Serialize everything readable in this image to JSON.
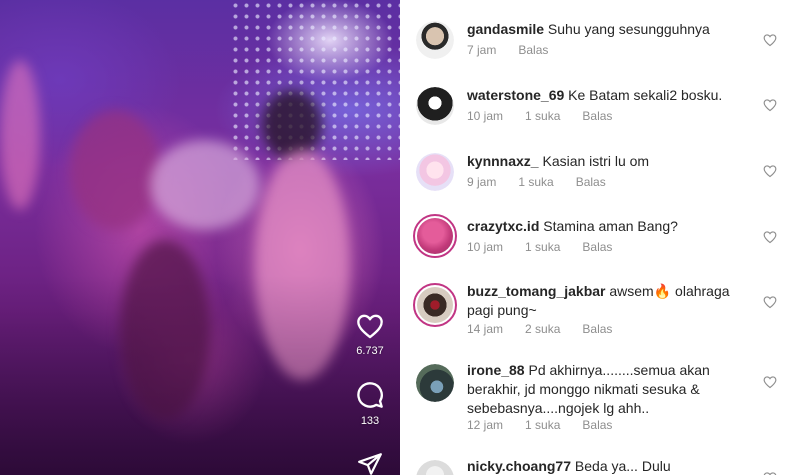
{
  "video": {
    "likes_count": "6.737",
    "comments_count": "133"
  },
  "comments": [
    {
      "username": "gandasmile",
      "text": "Suhu yang sesungguhnya",
      "time": "7 jam",
      "likes": "",
      "reply": "Balas"
    },
    {
      "username": "waterstone_69",
      "text": "Ke Batam sekali2 bosku.",
      "time": "10 jam",
      "likes": "1 suka",
      "reply": "Balas"
    },
    {
      "username": "kynnnaxz_",
      "text": "Kasian istri lu om",
      "time": "9 jam",
      "likes": "1 suka",
      "reply": "Balas"
    },
    {
      "username": "crazytxc.id",
      "text": "Stamina aman Bang?",
      "time": "10 jam",
      "likes": "1 suka",
      "reply": "Balas"
    },
    {
      "username": "buzz_tomang_jakbar",
      "text": "awsem🔥 olahraga pagi pung~",
      "time": "14 jam",
      "likes": "2 suka",
      "reply": "Balas"
    },
    {
      "username": "irone_88",
      "text": "Pd akhirnya........semua akan berakhir, jd monggo nikmati sesuka & sebebasnya....ngojek lg ahh..",
      "time": "12 jam",
      "likes": "1 suka",
      "reply": "Balas"
    },
    {
      "username": "nicky.choang77",
      "text": "Beda ya... Dulu",
      "time": "",
      "likes": "",
      "reply": ""
    }
  ],
  "colors": {
    "story_ring": "#c13584",
    "username": "#262626",
    "meta": "#8e8e8e"
  },
  "icons": {
    "like": "heart-icon",
    "comment": "comment-bubble-icon",
    "share": "send-icon",
    "comment_like": "small-heart-icon"
  }
}
